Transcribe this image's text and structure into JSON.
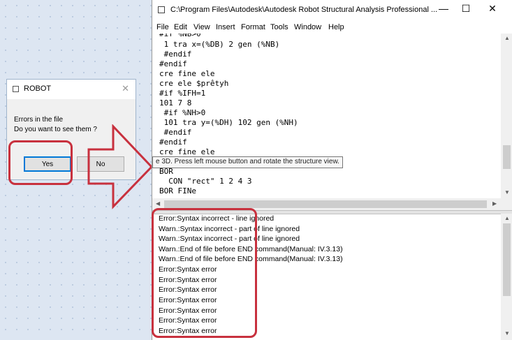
{
  "dialog": {
    "title": "ROBOT",
    "close_glyph": "✕",
    "message_line1": "Errors in the file",
    "message_line2": "Do you want to see them ?",
    "yes_label": "Yes",
    "no_label": "No"
  },
  "window": {
    "title": "C:\\Program Files\\Autodesk\\Autodesk Robot Structural Analysis Professional ...",
    "minimize_glyph": "—",
    "maximize_glyph": "☐",
    "close_glyph": "✕"
  },
  "menu": [
    "File",
    "Edit",
    "View",
    "Insert",
    "Format",
    "Tools",
    "Window",
    "Help"
  ],
  "editor": {
    "lines": [
      "#if %NB>0",
      " 1 tra x=(%DB) 2 gen (%NB)",
      " #endif",
      "#endif",
      "cre fine ele",
      "cre ele $prêtyh",
      "#if %IFH=1",
      "101 7 8",
      " #if %NH>0",
      " 101 tra y=(%DH) 102 gen (%NH)",
      " #endif",
      "#endif",
      "cre fine ele",
      "",
      "BOR",
      "  CON \"rect\" 1 2 4 3",
      "BOR FINe"
    ],
    "tooltip": "e 3D. Press left mouse button and rotate the structure view."
  },
  "log": {
    "lines": [
      "Error:Syntax incorrect - line ignored",
      "Warn.:Syntax incorrect - part of line ignored",
      "Warn.:Syntax incorrect - part of line ignored",
      "Warn.:End of file before END command(Manual: IV.3.13)",
      "Warn.:End of file before END command(Manual: IV.3.13)",
      "Error:Syntax error",
      "Error:Syntax error",
      "Error:Syntax error",
      "Error:Syntax error",
      "Error:Syntax error",
      "Error:Syntax error",
      "Error:Syntax error"
    ]
  },
  "colors": {
    "annotation_red": "#c8313e",
    "focus_blue": "#0078d7",
    "desktop_bg": "#dde6f2"
  },
  "icons": {
    "scroll_up": "▲",
    "scroll_down": "▼",
    "scroll_left": "◀",
    "scroll_right": "▶"
  }
}
